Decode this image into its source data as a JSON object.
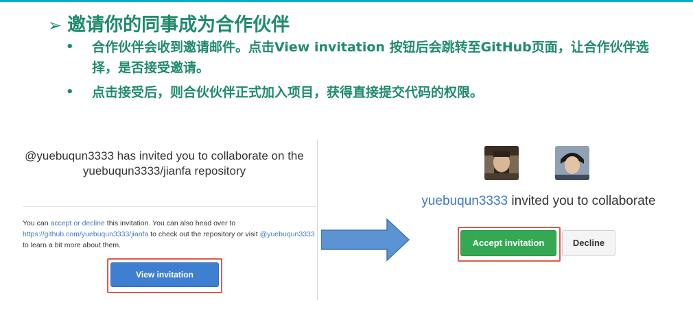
{
  "slide": {
    "title": "邀请你的同事成为合作伙伴",
    "bullets": [
      "合作伙伴会收到邀请邮件。点击View invitation 按钮后会跳转至GitHub页面，让合作伙伴选择，是否接受邀请。",
      "点击接受后，则合伙伙伴正式加入项目，获得直接提交代码的权限。"
    ]
  },
  "email": {
    "heading_line1": "@yuebuqun3333 has invited you to collaborate on the",
    "heading_line2": "yuebuqun3333/jianfa repository",
    "body": {
      "t1": "You can ",
      "link1": "accept or decline",
      "t2": " this invitation. You can also head over to ",
      "link2": "https://github.com/yuebuqun3333/jianfa",
      "t3": " to check out the repository or visit ",
      "link3": "@yuebuqun3333",
      "t4": " to learn a bit more about them."
    },
    "view_button": "View invitation"
  },
  "github": {
    "inviter": "yuebuqun3333",
    "message": " invited you to collaborate",
    "accept_button": "Accept invitation",
    "decline_button": "Decline"
  },
  "colors": {
    "accent_green": "#1f8a6e",
    "button_blue": "#3f7fd1",
    "button_green": "#34a853",
    "highlight_red": "#e2574c",
    "link_blue": "#4078c0"
  }
}
